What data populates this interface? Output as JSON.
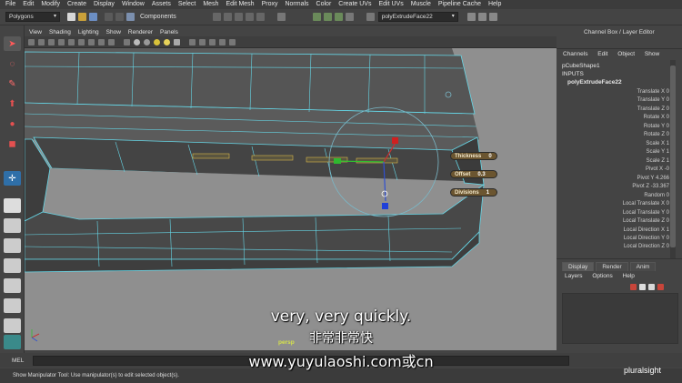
{
  "menubar": [
    "File",
    "Edit",
    "Modify",
    "Create",
    "Display",
    "Window",
    "Assets",
    "Select",
    "Mesh",
    "Edit Mesh",
    "Proxy",
    "Normals",
    "Color",
    "Create UVs",
    "Edit UVs",
    "Muscle",
    "Pipeline Cache",
    "Help"
  ],
  "statusline": {
    "menu_set": "Polygons",
    "selection_mode": "Components",
    "name_field": "polyExtrudeFace22"
  },
  "panel": {
    "menu": [
      "View",
      "Shading",
      "Lighting",
      "Show",
      "Renderer",
      "Panels"
    ],
    "camera": "persp"
  },
  "hud": {
    "thickness_label": "Thickness",
    "thickness_value": "0",
    "offset_label": "Offset",
    "offset_value": "0.3",
    "divisions_label": "Divisions",
    "divisions_value": "1"
  },
  "channel_box": {
    "title": "Channel Box / Layer Editor",
    "menu": [
      "Channels",
      "Edit",
      "Object",
      "Show"
    ],
    "shape": "pCubeShape1",
    "inputs": "INPUTS",
    "node": "polyExtrudeFace22",
    "rows": [
      "Translate X 0",
      "Translate Y 0",
      "Translate Z 0",
      "Rotate X 0",
      "Rotate Y 0",
      "Rotate Z 0",
      "Scale X 1",
      "Scale Y 1",
      "Scale Z 1",
      "Pivot X -0",
      "Pivot Y 4.266",
      "Pivot Z -33.367",
      "Random 0",
      "Local Translate X 0",
      "Local Translate Y 0",
      "Local Translate Z 0",
      "Local Direction X 1",
      "Local Direction Y 0",
      "Local Direction Z 0"
    ]
  },
  "layer_editor": {
    "tabs": [
      "Display",
      "Render",
      "Anim"
    ],
    "menu": [
      "Layers",
      "Options",
      "Help"
    ]
  },
  "mel_label": "MEL",
  "help_line": "Show Manipulator Tool: Use manipulator(s) to edit selected object(s).",
  "subtitle_en": "very, very quickly.",
  "subtitle_cn": "非常非常快",
  "watermark": "www.yuyulaoshi.com或cn",
  "brand": "pluralsight",
  "colors": {
    "wireframe": "#66d6e6",
    "mesh_dark": "#3f3f3f",
    "viewport_bg": "#8f8f8f",
    "hud_tag": "#6b5530"
  }
}
